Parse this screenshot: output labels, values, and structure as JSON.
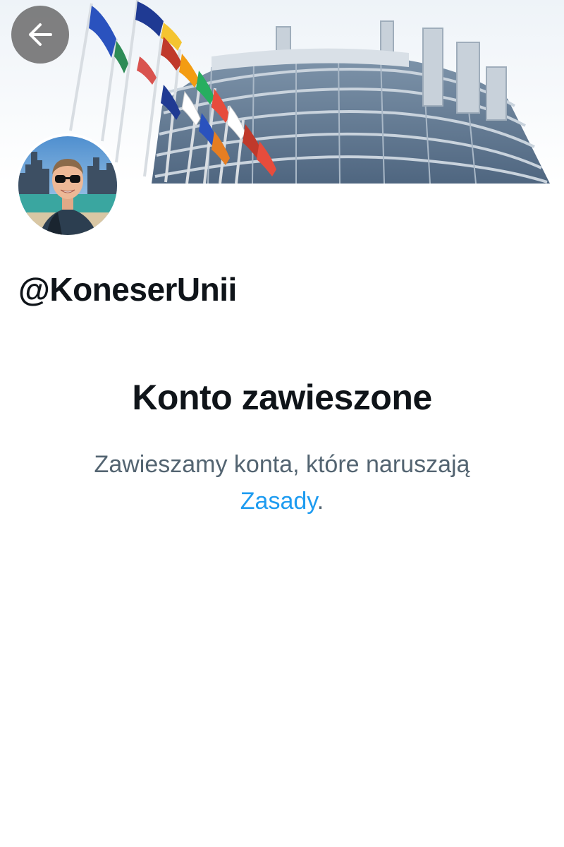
{
  "header": {
    "back_icon": "arrow-left-icon",
    "banner_image": "european-parliament-building-with-flags"
  },
  "profile": {
    "handle": "@KoneserUnii",
    "avatar_image": "man-with-sunglasses-city-skyline"
  },
  "suspension": {
    "title": "Konto zawieszone",
    "description": "Zawieszamy konta, które naruszają",
    "link_text": "Zasady",
    "suffix": "."
  },
  "colors": {
    "text_primary": "#0f1419",
    "text_secondary": "#536471",
    "link": "#1d9bf0",
    "back_button_bg": "#6e6e6e"
  }
}
